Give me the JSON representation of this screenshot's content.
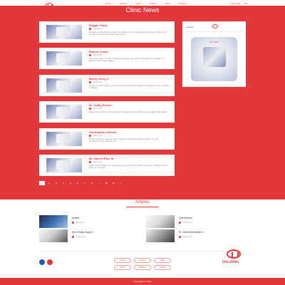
{
  "header": {
    "logo_text": "Uro-clinic",
    "nav": [
      "Home",
      "Doctors",
      "News",
      "Articles",
      "Clinic",
      "Booking"
    ],
    "lang": [
      "Language",
      "EN"
    ]
  },
  "page": {
    "title": "Clinic News"
  },
  "news": [
    {
      "title": "Reggie Grant",
      "date": "2019-11-12",
      "excerpt": "Excepteur sint occaecat cupidatat non proident, sunt in culpa qui officia deserunt mollit anim id est laborum. Sed ut perspiciatis unde omnis."
    },
    {
      "title": "Beanie Crowd",
      "date": "2019-11-12",
      "excerpt": "Lorem ipsum dolor sit amet, consectetur adipiscing elit, sed do eiusmod tempor incididunt ut labore et dolore magna aliqua."
    },
    {
      "title": "Macey Corry V",
      "date": "2019-11-12",
      "excerpt": "Ut enim ad minim veniam, quis nostrud exercitation ullamco laboris nisi ut aliquip ex ea commodo consequat."
    },
    {
      "title": "Dr. Colby Ernser",
      "date": "2019-11-12",
      "excerpt": "Duis aute irure dolor in reprehenderit in voluptate velit esse cillum dolore eu fugiat nulla pariatur."
    },
    {
      "title": "Christopher O'Keefe",
      "date": "2019-11-12",
      "excerpt": "Nemo enim ipsam voluptatem quia voluptas sit aspernatur aut odit aut fugit, sed quia consequuntur magni dolores eos."
    },
    {
      "title": "Mr. Darren Rice Sr.",
      "date": "2019-11-12",
      "excerpt": "Neque porro quisquam est, qui dolorem ipsum quia dolor sit amet, consectetur, adipisci velit, sed quia non numquam."
    }
  ],
  "widget": {
    "page_name": "Uro-clinic",
    "poster_title": "Uro-clinic"
  },
  "pagination": [
    "1",
    "2",
    "3",
    "4",
    "5",
    "6",
    "7",
    "8",
    "...",
    "15",
    "16",
    "»"
  ],
  "articles_section": {
    "title": "Articles",
    "items": [
      {
        "title": "ambed",
        "date": "2019-11-12"
      },
      {
        "title": "Cole Bednar",
        "date": "2019-11-12"
      },
      {
        "title": "Mrs. Emely Krapp II",
        "date": "2019-11-12"
      },
      {
        "title": "Dr. Vidal Greenfelder II",
        "date": "2019-11-12"
      }
    ]
  },
  "footer": {
    "links": [
      "Home",
      "Doctors",
      "News",
      "Clinic",
      "Booking",
      "Contact"
    ],
    "logo_text": "Uro-clinic",
    "copyright": "Copyrights © 2019"
  },
  "colors": {
    "brand": "#e3383b",
    "text": "#444444"
  }
}
